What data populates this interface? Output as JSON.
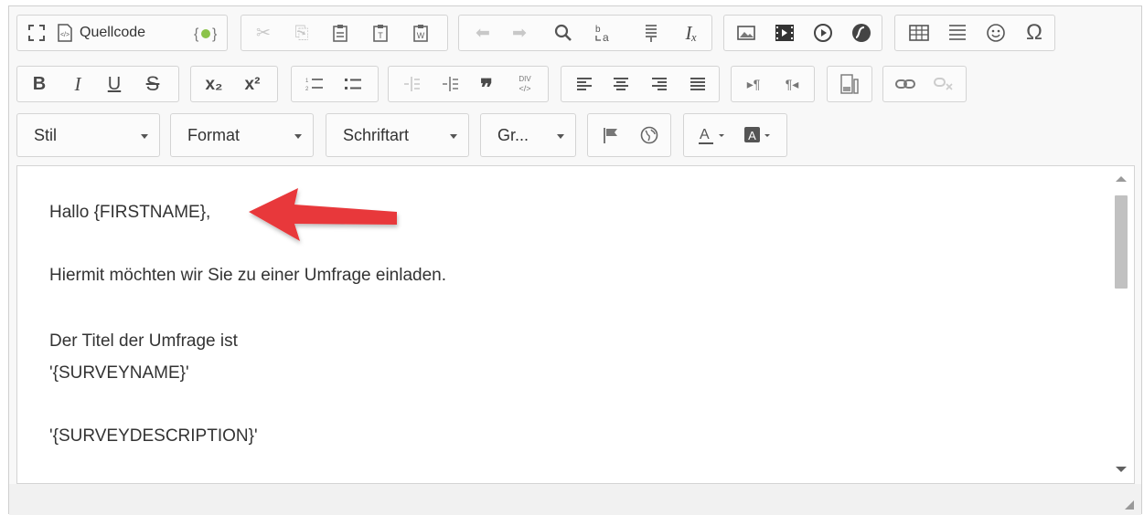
{
  "toolbar": {
    "source_label": "Quellcode",
    "style_combo": "Stil",
    "format_combo": "Format",
    "font_combo": "Schriftart",
    "size_combo": "Gr..."
  },
  "content": {
    "lines": [
      "Hallo {FIRSTNAME},",
      "Hiermit möchten wir Sie zu einer Umfrage einladen.",
      "Der Titel der Umfrage ist",
      "'{SURVEYNAME}'",
      "'{SURVEYDESCRIPTION}'"
    ]
  },
  "colors": {
    "annotation_arrow": "#e8393b",
    "toolbar_bg": "#f8f8f8"
  }
}
